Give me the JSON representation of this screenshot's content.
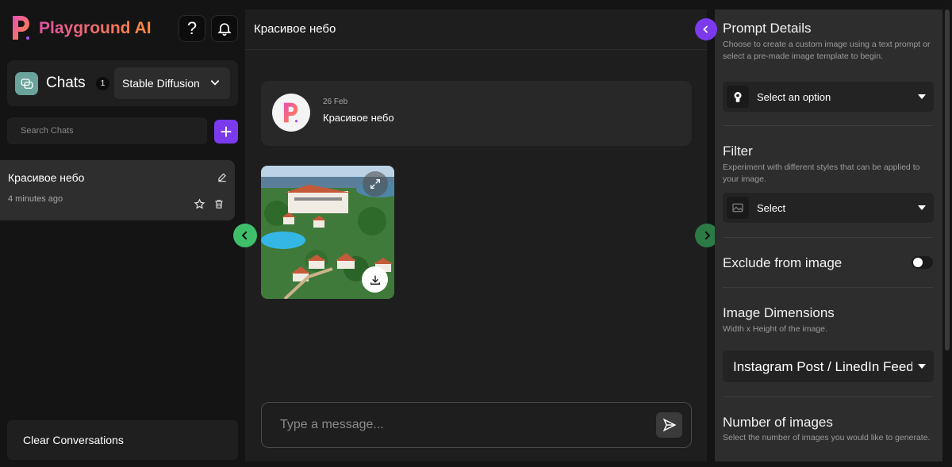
{
  "app": {
    "name": "Playground AI"
  },
  "header": {
    "help_glyph": "?"
  },
  "sidebar": {
    "chats_title": "Chats",
    "chats_count": "1",
    "model_selected": "Stable Diffusion",
    "search_placeholder": "Search Chats",
    "add_glyph": "+",
    "chat_items": [
      {
        "title": "Красивое небо",
        "time": "4 minutes ago"
      }
    ],
    "clear_label": "Clear Conversations"
  },
  "main": {
    "title": "Красивое небо",
    "message": {
      "date": "26 Feb",
      "text": "Красивое небо"
    },
    "composer_placeholder": "Type a message..."
  },
  "panel": {
    "prompt_details": {
      "title": "Prompt Details",
      "desc": "Choose to create a custom image using a text prompt or select a pre-made image template to begin.",
      "select_label": "Select an option"
    },
    "filter": {
      "title": "Filter",
      "desc": "Experiment with different styles that can be applied to your image.",
      "select_label": "Select"
    },
    "exclude": {
      "title": "Exclude from image",
      "enabled": false
    },
    "dimensions": {
      "title": "Image Dimensions",
      "desc": "Width x Height of the image.",
      "select_label": "Instagram Post / LinedIn Feed"
    },
    "number_images": {
      "title": "Number of images",
      "desc": "Select the number of images you would like to generate."
    }
  },
  "colors": {
    "accent": "#7c3aed",
    "nav_green": "#3fbf6a",
    "bg": "#141414"
  }
}
